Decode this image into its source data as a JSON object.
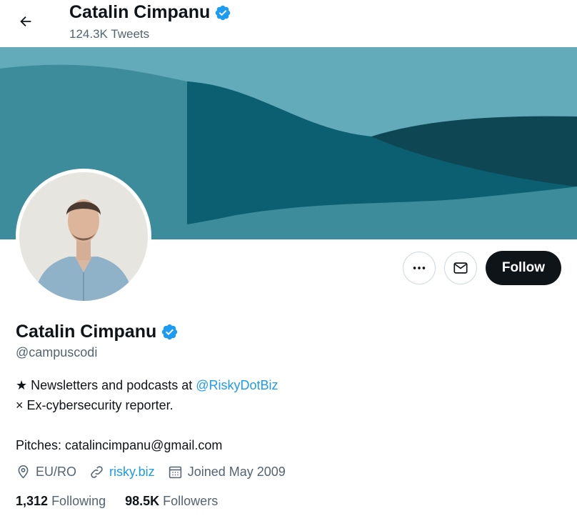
{
  "header": {
    "display_name": "Catalin Cimpanu",
    "tweet_count": "124.3K Tweets",
    "back_icon": "arrow-left-icon"
  },
  "profile": {
    "display_name": "Catalin Cimpanu",
    "handle": "@campuscodi",
    "verified_badge": "verified-badge-icon",
    "bio": {
      "line1_prefix": "★ Newsletters and podcasts at ",
      "line1_link": "@RiskyDotBiz",
      "line2": "×  Ex-cybersecurity reporter.",
      "line4": "Pitches: catalincimpanu@gmail.com"
    },
    "location": "EU/RO",
    "website": "risky.biz",
    "joined": "Joined May 2009",
    "following_count": "1,312",
    "following_label": "Following",
    "followers_count": "98.5K",
    "followers_label": "Followers"
  },
  "actions": {
    "more_icon": "more-horizontal-icon",
    "message_icon": "envelope-icon",
    "follow_label": "Follow"
  },
  "colors": {
    "accent": "#1d9bf0",
    "text_primary": "#0f1419",
    "text_secondary": "#536471",
    "banner_light": "#63aabb",
    "banner_mid": "#3d8c9c",
    "banner_dark": "#0b5f70",
    "banner_darkest": "#0e4654"
  }
}
